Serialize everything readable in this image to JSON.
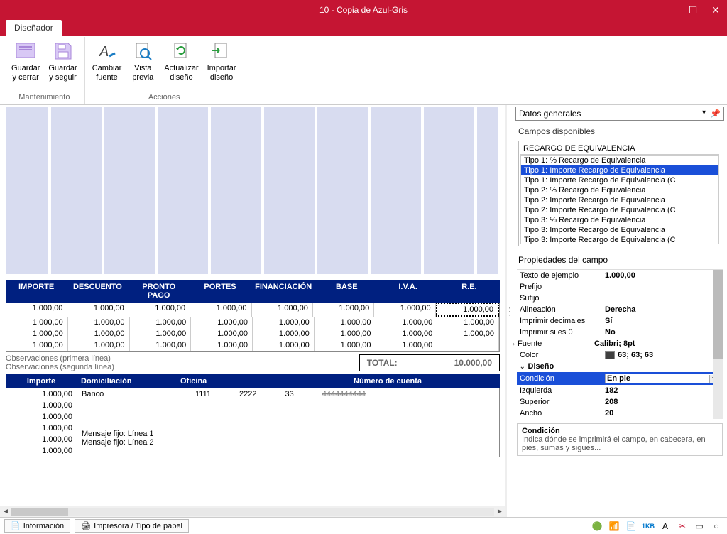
{
  "window": {
    "title": "10 - Copia de Azul-Gris"
  },
  "tab": {
    "label": "Diseñador"
  },
  "ribbon": {
    "group1_label": "Mantenimiento",
    "group2_label": "Acciones",
    "btn_save_close": "Guardar\ny cerrar",
    "btn_save_cont": "Guardar\ny seguir",
    "btn_font": "Cambiar\nfuente",
    "btn_preview": "Vista\nprevia",
    "btn_refresh": "Actualizar\ndiseño",
    "btn_import": "Importar\ndiseño"
  },
  "headers": [
    "IMPORTE",
    "DESCUENTO",
    "PRONTO PAGO",
    "PORTES",
    "FINANCIACIÓN",
    "BASE",
    "I.V.A.",
    "R.E."
  ],
  "rows": [
    [
      "1.000,00",
      "1.000,00",
      "1.000,00",
      "1.000,00",
      "1.000,00",
      "1.000,00",
      "1.000,00",
      "1.000,00"
    ],
    [
      "1.000,00",
      "1.000,00",
      "1.000,00",
      "1.000,00",
      "1.000,00",
      "1.000,00",
      "1.000,00",
      "1.000,00"
    ],
    [
      "1.000,00",
      "1.000,00",
      "1.000,00",
      "1.000,00",
      "1.000,00",
      "1.000,00",
      "1.000,00",
      "1.000,00"
    ],
    [
      "1.000,00",
      "1.000,00",
      "1.000,00",
      "1.000,00",
      "1.000,00",
      "1.000,00",
      "1.000,00",
      ""
    ]
  ],
  "obs": {
    "line1": "Observaciones (primera línea)",
    "line2": "Observaciones (segunda línea)"
  },
  "total": {
    "label": "TOTAL:",
    "value": "10.000,00"
  },
  "bank_headers": {
    "importe": "Importe",
    "dom": "Domiciliación",
    "oficina": "Oficina",
    "cuenta": "Número de cuenta"
  },
  "bank": {
    "amounts": [
      "1.000,00",
      "1.000,00",
      "1.000,00",
      "1.000,00",
      "1.000,00",
      "1.000,00"
    ],
    "banco": "Banco",
    "v1": "1111",
    "v2": "2222",
    "v3": "33",
    "v4": "4444444444",
    "msg1": "Mensaje fijo: Línea 1",
    "msg2": "Mensaje fijo: Línea 2"
  },
  "rpanel": {
    "combo": "Datos generales",
    "section_fields": "Campos disponibles",
    "category": "RECARGO DE EQUIVALENCIA",
    "fields": [
      "Tipo 1: % Recargo de Equivalencia",
      "Tipo 1: Importe Recargo de Equivalencia",
      "Tipo 1: Importe Recargo de Equivalencia (C",
      "Tipo 2: % Recargo de Equivalencia",
      "Tipo 2: Importe Recargo de Equivalencia",
      "Tipo 2: Importe Recargo de Equivalencia (C",
      "Tipo 3: % Recargo de Equivalencia",
      "Tipo 3: Importe Recargo de Equivalencia",
      "Tipo 3: Importe Recargo de Equivalencia (C"
    ],
    "selected_field_index": 1,
    "section_props": "Propiedades del campo",
    "props": {
      "texto_k": "Texto de ejemplo",
      "texto_v": "1.000,00",
      "prefijo_k": "Prefijo",
      "prefijo_v": "",
      "sufijo_k": "Sufijo",
      "sufijo_v": "",
      "align_k": "Alineación",
      "align_v": "Derecha",
      "dec_k": "Imprimir decimales",
      "dec_v": "Sí",
      "zero_k": "Imprimir si es 0",
      "zero_v": "No",
      "fuente_k": "Fuente",
      "fuente_v": "Calibri; 8pt",
      "color_k": "Color",
      "color_v": "63; 63; 63",
      "diseno": "Diseño",
      "cond_k": "Condición",
      "cond_v": "En pie",
      "izq_k": "Izquierda",
      "izq_v": "182",
      "sup_k": "Superior",
      "sup_v": "208",
      "ancho_k": "Ancho",
      "ancho_v": "20"
    },
    "help_title": "Condición",
    "help_text": "Indica dónde se imprimirá el campo, en cabecera, en pies, sumas y sigues..."
  },
  "statusbar": {
    "info": "Información",
    "printer": "Impresora / Tipo de papel"
  }
}
